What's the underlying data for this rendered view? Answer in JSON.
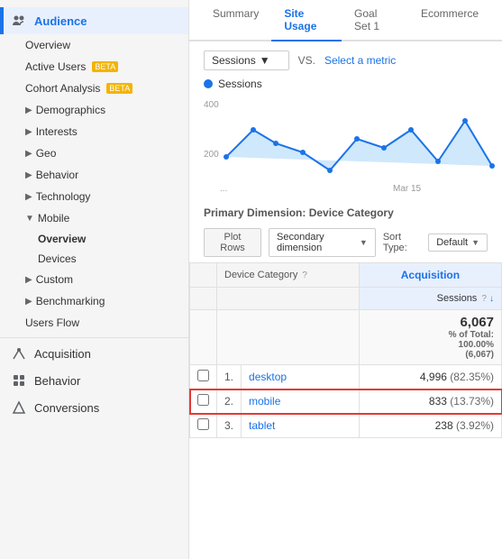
{
  "sidebar": {
    "sections": [
      {
        "id": "audience",
        "label": "Audience",
        "icon": "audience-icon",
        "active": true,
        "items": [
          {
            "id": "overview",
            "label": "Overview",
            "level": 1
          },
          {
            "id": "active-users",
            "label": "Active Users",
            "level": 1,
            "badge": "BETA"
          },
          {
            "id": "cohort-analysis",
            "label": "Cohort Analysis",
            "level": 1,
            "badge": "BETA"
          },
          {
            "id": "demographics",
            "label": "Demographics",
            "level": 1,
            "arrow": true
          },
          {
            "id": "interests",
            "label": "Interests",
            "level": 1,
            "arrow": true
          },
          {
            "id": "geo",
            "label": "Geo",
            "level": 1,
            "arrow": true
          },
          {
            "id": "behavior",
            "label": "Behavior",
            "level": 1,
            "arrow": true
          },
          {
            "id": "technology",
            "label": "Technology",
            "level": 1,
            "arrow": true
          },
          {
            "id": "mobile",
            "label": "Mobile",
            "level": 1,
            "expanded": true
          },
          {
            "id": "mobile-overview",
            "label": "Overview",
            "level": 2,
            "active": true
          },
          {
            "id": "mobile-devices",
            "label": "Devices",
            "level": 2
          },
          {
            "id": "custom",
            "label": "Custom",
            "level": 1,
            "arrow": true
          },
          {
            "id": "benchmarking",
            "label": "Benchmarking",
            "level": 1,
            "arrow": true
          },
          {
            "id": "users-flow",
            "label": "Users Flow",
            "level": 1
          }
        ]
      },
      {
        "id": "acquisition",
        "label": "Acquisition",
        "icon": "acquisition-icon"
      },
      {
        "id": "behavior",
        "label": "Behavior",
        "icon": "behavior-icon"
      },
      {
        "id": "conversions",
        "label": "Conversions",
        "icon": "conversions-icon"
      }
    ]
  },
  "main": {
    "tabs": [
      {
        "id": "summary",
        "label": "Summary"
      },
      {
        "id": "site-usage",
        "label": "Site Usage"
      },
      {
        "id": "goal-set-1",
        "label": "Goal Set 1"
      },
      {
        "id": "ecommerce",
        "label": "Ecommerce"
      }
    ],
    "active_tab": "summary",
    "chart": {
      "metric_label": "Sessions",
      "vs_label": "VS.",
      "select_metric_label": "Select a metric",
      "y_labels": [
        "400",
        "200"
      ],
      "x_label": "Mar 15"
    },
    "primary_dimension": {
      "label": "Primary Dimension:",
      "value": "Device Category"
    },
    "controls": {
      "plot_rows_label": "Plot Rows",
      "secondary_dim_label": "Secondary dimension",
      "sort_type_label": "Sort Type:",
      "sort_value": "Default"
    },
    "table": {
      "headers": {
        "device_category": "Device Category",
        "acquisition": "Acquisition",
        "sessions": "Sessions"
      },
      "total": {
        "sessions_value": "6,067",
        "sessions_pct": "% of Total:",
        "sessions_total": "100.00%",
        "sessions_count": "(6,067)"
      },
      "rows": [
        {
          "num": "1.",
          "device": "desktop",
          "sessions": "4,996",
          "sessions_pct": "(82.35%)"
        },
        {
          "num": "2.",
          "device": "mobile",
          "sessions": "833",
          "sessions_pct": "(13.73%)",
          "highlighted": true
        },
        {
          "num": "3.",
          "device": "tablet",
          "sessions": "238",
          "sessions_pct": "(3.92%)"
        }
      ]
    }
  },
  "colors": {
    "accent": "#1a73e8",
    "highlight_border": "#e53935",
    "chart_line": "#1a73e8",
    "chart_fill": "#bbdefb"
  }
}
